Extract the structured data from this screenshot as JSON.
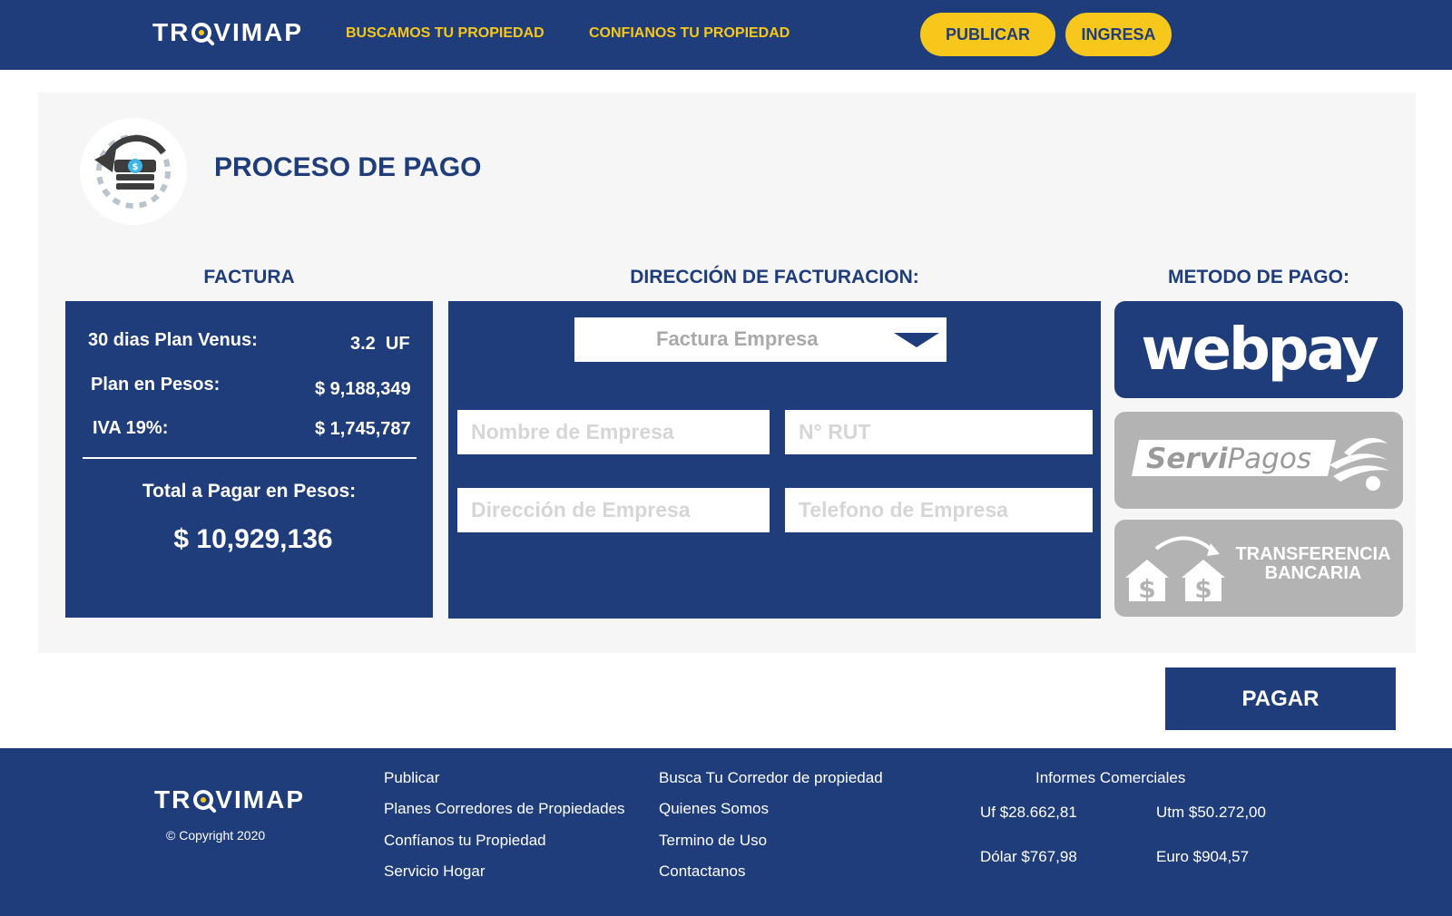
{
  "header": {
    "logo": "TROVIMAP",
    "nav": [
      "BUSCAMOS TU PROPIEDAD",
      "CONFIANOS TU PROPIEDAD"
    ],
    "publish_label": "PUBLICAR",
    "login_label": "INGRESA"
  },
  "page": {
    "title": "PROCESO DE PAGO",
    "icon": "payment-cycle-icon"
  },
  "invoice": {
    "heading": "FACTURA",
    "plan_label": "30 dias Plan Venus:",
    "plan_value": "3.2  UF",
    "pesos_label": "Plan en Pesos:",
    "pesos_value": "$ 9,188,349",
    "iva_label": "IVA 19%:",
    "iva_value": "$ 1,745,787",
    "total_label": "Total a Pagar en Pesos:",
    "total_value": "$ 10,929,136"
  },
  "billing": {
    "heading": "DIRECCIÓN DE FACTURACION:",
    "type_selected": "Factura Empresa",
    "company_name_placeholder": "Nombre de Empresa",
    "rut_placeholder": "N° RUT",
    "address_placeholder": "Dirección de Empresa",
    "phone_placeholder": "Telefono de Empresa"
  },
  "payment": {
    "heading": "METODO DE PAGO:",
    "methods": [
      {
        "label": "webpay",
        "color": "#1f3d7a"
      },
      {
        "label": "ServiPagos",
        "color": "#b3b3b3"
      },
      {
        "label_line1": "TRANSFERENCIA",
        "label_line2": "BANCARIA",
        "color": "#b3b3b3"
      }
    ],
    "pay_button": "PAGAR"
  },
  "footer": {
    "logo": "TROVIMAP",
    "copyright": "© Copyright 2020",
    "col1": [
      "Publicar",
      "Planes Corredores de Propiedades",
      "Confíanos tu Propiedad",
      "Servicio Hogar"
    ],
    "col2": [
      "Busca Tu Corredor de propiedad",
      "Quienes Somos",
      "Termino de Uso",
      "Contactanos"
    ],
    "reports_title": "Informes Comerciales",
    "uf": "Uf $28.662,81",
    "utm": "Utm $50.272,00",
    "dolar": "Dólar $767,98",
    "euro": "Euro $904,57"
  },
  "colors": {
    "brand_blue": "#1f3d7a",
    "accent_yellow": "#f7c71c",
    "inactive_gray": "#b3b3b3"
  }
}
